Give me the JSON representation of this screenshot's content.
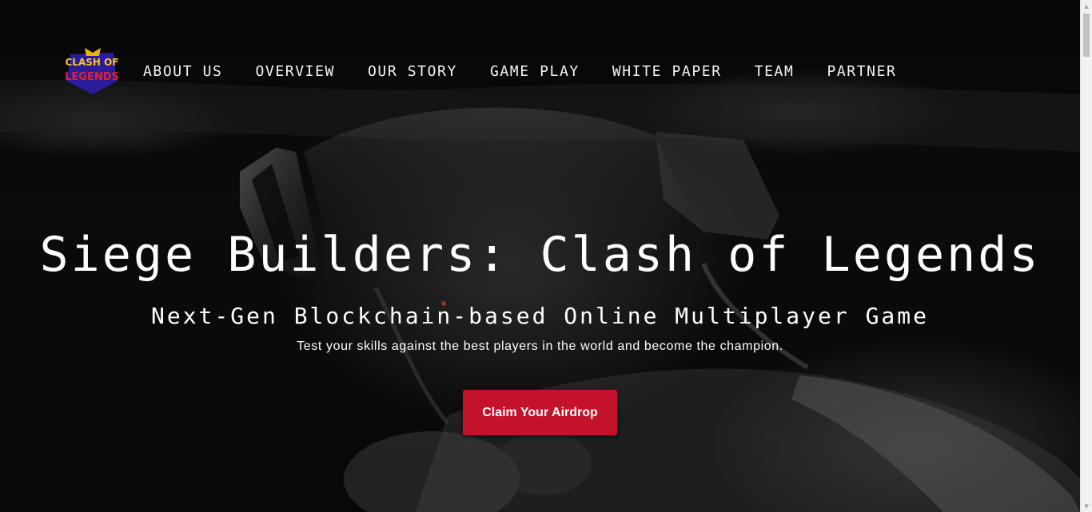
{
  "brand": {
    "logo_text_line1": "CLASH OF",
    "logo_text_line2": "LEGENDS"
  },
  "nav": {
    "items": [
      {
        "label": "ABOUT US"
      },
      {
        "label": "OVERVIEW"
      },
      {
        "label": "OUR STORY"
      },
      {
        "label": "GAME PLAY"
      },
      {
        "label": "WHITE PAPER"
      },
      {
        "label": "TEAM"
      },
      {
        "label": "PARTNER"
      }
    ]
  },
  "hero": {
    "title": "Siege Builders: Clash of Legends",
    "subtitle": "Next-Gen Blockchain-based Online Multiplayer Game",
    "description": "Test your skills against the best players in the world and become the champion.",
    "cta_label": "Claim Your Airdrop"
  },
  "colors": {
    "accent": "#c4122c",
    "background": "#050505",
    "text": "#ffffff"
  },
  "icons": {
    "logo": "clash-of-legends-logo-icon",
    "scroll_up": "scroll-up-arrow-icon",
    "scroll_down": "scroll-down-arrow-icon"
  }
}
